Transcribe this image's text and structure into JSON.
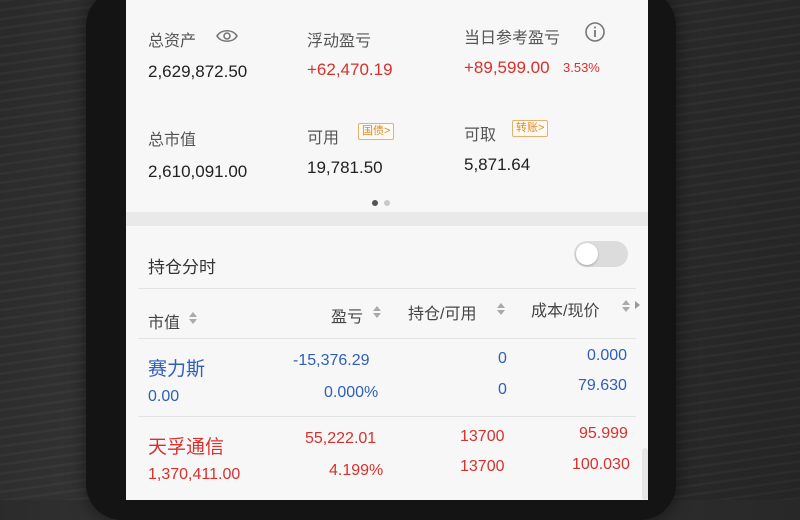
{
  "summary": {
    "total_assets_label": "总资产",
    "total_assets_value": "2,629,872.50",
    "floating_pl_label": "浮动盈亏",
    "floating_pl_value": "+62,470.19",
    "daily_pl_label": "当日参考盈亏",
    "daily_pl_value": "+89,599.00",
    "daily_pl_pct": "3.53%",
    "market_value_label": "总市值",
    "market_value_value": "2,610,091.00",
    "available_label": "可用",
    "available_value": "19,781.50",
    "available_tag": "国债>",
    "withdrawable_label": "可取",
    "withdrawable_value": "5,871.64",
    "withdrawable_tag": "转账>",
    "icons": [
      "eye-icon",
      "info-icon"
    ],
    "pager_active_index": 0
  },
  "holdings_section": {
    "title": "持仓分时",
    "toggle_on": false
  },
  "table": {
    "headers": [
      "市值",
      "盈亏",
      "持仓/可用",
      "成本/现价"
    ],
    "rows": [
      {
        "name": "赛力斯",
        "market_value": "0.00",
        "pl": "-15,376.29",
        "pl_pct": "0.000%",
        "position": "0",
        "available": "0",
        "cost": "0.000",
        "price": "79.630",
        "color": "#2f5fb8"
      },
      {
        "name": "天孚通信",
        "market_value": "1,370,411.00",
        "pl": "55,222.01",
        "pl_pct": "4.199%",
        "position": "13700",
        "available": "13700",
        "cost": "95.999",
        "price": "100.030",
        "color": "#d7312d"
      }
    ]
  },
  "colors": {
    "gain": "#d7312d",
    "loss": "#2f5fb8",
    "tag_orange": "#d98a2b"
  }
}
